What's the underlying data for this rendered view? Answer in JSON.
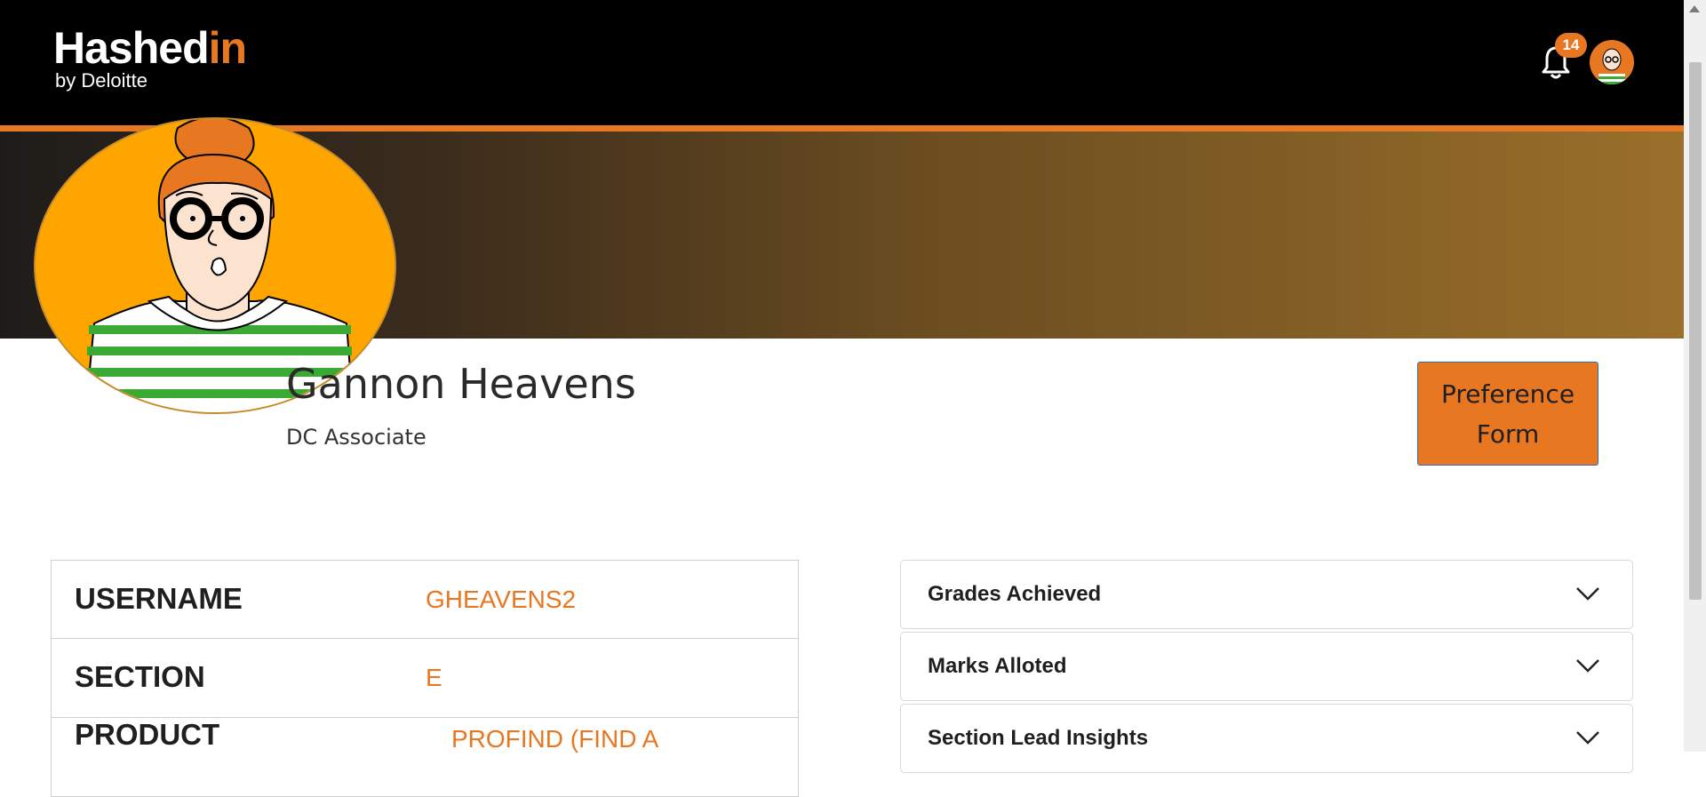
{
  "header": {
    "logo_main_prefix": "Hashed",
    "logo_main_accent": "in",
    "logo_sub": "by Deloitte",
    "notification_count": "14",
    "icons": {
      "bell": "bell-icon",
      "avatar": "user-avatar"
    }
  },
  "profile": {
    "name": "Gannon Heavens",
    "role": "DC Associate",
    "preference_button": "Preference Form"
  },
  "info": [
    {
      "label": "USERNAME",
      "value": "GHEAVENS2"
    },
    {
      "label": "SECTION",
      "value": "E"
    },
    {
      "label": "PRODUCT",
      "value": "PROFIND (FIND A"
    }
  ],
  "accordions": [
    {
      "title": "Grades Achieved"
    },
    {
      "title": "Marks Alloted"
    },
    {
      "title": "Section Lead Insights"
    }
  ],
  "colors": {
    "accent": "#e87722",
    "header_bg": "#000000",
    "avatar_bg": "#ffa500"
  }
}
